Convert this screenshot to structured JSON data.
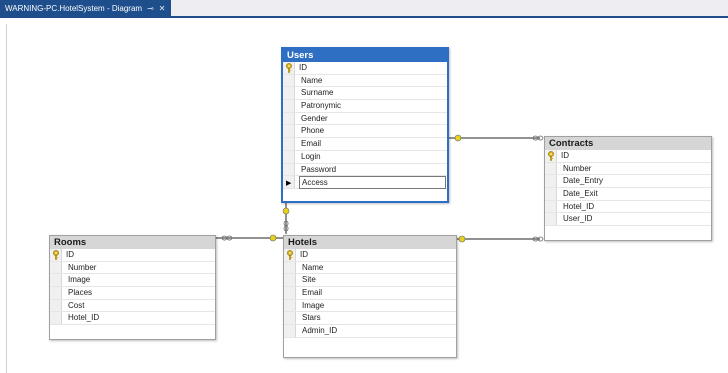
{
  "tab": {
    "title": "WARNING-PC.HotelSystem - Diagram",
    "pin_glyph": "⊸",
    "close_glyph": "✕"
  },
  "icons": {
    "key": "key-icon",
    "row_selector": "row-selector-arrow-icon"
  },
  "colors": {
    "tab_bg": "#1f4e8c",
    "selected_border": "#2e6fc4",
    "key_color": "#d9b11c",
    "connector": "#6d6d6d",
    "connector_end": "#e8d11a"
  },
  "tables": {
    "users": {
      "title": "Users",
      "fields": [
        "ID",
        "Name",
        "Surname",
        "Patronymic",
        "Gender",
        "Phone",
        "Email",
        "Login",
        "Password",
        "Access"
      ]
    },
    "contracts": {
      "title": "Contracts",
      "fields": [
        "ID",
        "Number",
        "Date_Entry",
        "Date_Exit",
        "Hotel_ID",
        "User_ID"
      ]
    },
    "rooms": {
      "title": "Rooms",
      "fields": [
        "ID",
        "Number",
        "Image",
        "Places",
        "Cost",
        "Hotel_ID"
      ]
    },
    "hotels": {
      "title": "Hotels",
      "fields": [
        "ID",
        "Name",
        "Site",
        "Email",
        "Image",
        "Stars",
        "Admin_ID"
      ]
    }
  }
}
